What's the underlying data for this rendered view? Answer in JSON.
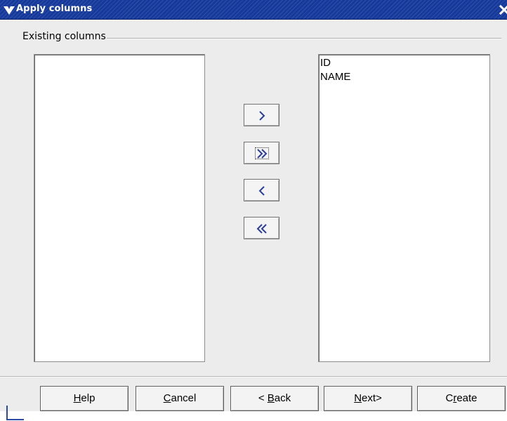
{
  "window": {
    "title": "Apply columns"
  },
  "group": {
    "label": "Existing columns"
  },
  "available_columns": [],
  "selected_columns": [
    "ID",
    "NAME"
  ],
  "move_buttons": {
    "add_one": "›",
    "add_all": "»",
    "remove_one": "‹",
    "remove_all": "«"
  },
  "buttons": {
    "help": {
      "pre": "",
      "mnemonic": "H",
      "post": "elp"
    },
    "cancel": {
      "pre": "",
      "mnemonic": "C",
      "post": "ancel"
    },
    "back": {
      "pre": "< ",
      "mnemonic": "B",
      "post": "ack"
    },
    "next": {
      "pre": "",
      "mnemonic": "N",
      "post": "ext>"
    },
    "create": {
      "pre": "C",
      "mnemonic": "r",
      "post": "eate"
    }
  },
  "colors": {
    "titlebar": "#163a9c",
    "arrow": "#2b3f9a",
    "dialog_bg": "#ececec"
  }
}
